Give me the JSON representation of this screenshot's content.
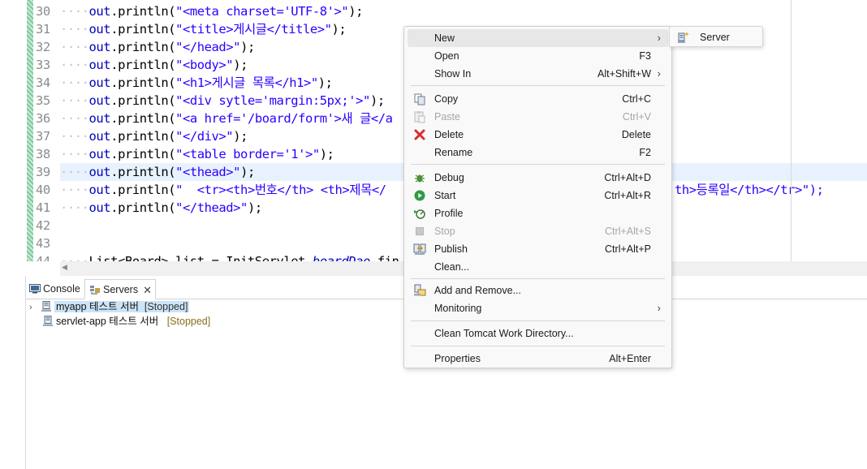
{
  "editor": {
    "lines": [
      {
        "num": "30",
        "ws": "····",
        "pre": "out",
        "mid": ".println(",
        "str": "\"<meta charset='UTF-8'>\"",
        "post": ");"
      },
      {
        "num": "31",
        "ws": "····",
        "pre": "out",
        "mid": ".println(",
        "str": "\"<title>게시글</title>\"",
        "post": ");"
      },
      {
        "num": "32",
        "ws": "····",
        "pre": "out",
        "mid": ".println(",
        "str": "\"</head>\"",
        "post": ");"
      },
      {
        "num": "33",
        "ws": "····",
        "pre": "out",
        "mid": ".println(",
        "str": "\"<body>\"",
        "post": ");"
      },
      {
        "num": "34",
        "ws": "····",
        "pre": "out",
        "mid": ".println(",
        "str": "\"<h1>게시글 목록</h1>\"",
        "post": ");"
      },
      {
        "num": "35",
        "ws": "····",
        "pre": "out",
        "mid": ".println(",
        "str": "\"<div sytle='margin:5px;'>\"",
        "post": ");"
      },
      {
        "num": "36",
        "ws": "····",
        "pre": "out",
        "mid": ".println(",
        "str": "\"<a href='/board/form'>새 글</a",
        "post": ""
      },
      {
        "num": "37",
        "ws": "····",
        "pre": "out",
        "mid": ".println(",
        "str": "\"</div>\"",
        "post": ");"
      },
      {
        "num": "38",
        "ws": "····",
        "pre": "out",
        "mid": ".println(",
        "str": "\"<table border='1'>\"",
        "post": ");"
      },
      {
        "num": "39",
        "ws": "····",
        "pre": "out",
        "mid": ".println(",
        "str": "\"<thead>\"",
        "post": ");"
      },
      {
        "num": "40",
        "ws": "····",
        "pre": "out",
        "mid": ".println(",
        "str": "\"  <tr><th>번호</th> <th>제목</",
        "post": ""
      },
      {
        "num": "41",
        "ws": "····",
        "pre": "out",
        "mid": ".println(",
        "str": "\"</thead>\"",
        "post": ");"
      },
      {
        "num": "42",
        "ws": "",
        "pre": "",
        "mid": "",
        "str": "",
        "post": ""
      },
      {
        "num": "43",
        "ws": "",
        "pre": "",
        "mid": "",
        "str": "",
        "post": ""
      },
      {
        "num": "44",
        "ws": "····",
        "pre": "List<Board> list = InitServlet.",
        "mid": "",
        "str": "",
        "post": "",
        "ital": "boardDao",
        "tail": ".fin"
      }
    ],
    "line40_tail": "th>등록일</th></tr>\");"
  },
  "panel": {
    "tabs": {
      "console": "Console",
      "servers": "Servers",
      "close": "✕"
    },
    "servers": [
      {
        "name": "myapp 테스트 서버",
        "status": "[Stopped]",
        "expander": "›"
      },
      {
        "name": "servlet-app 테스트 서버",
        "status": "[Stopped]"
      }
    ]
  },
  "context_menu": {
    "items": [
      {
        "label": "New",
        "accel": "",
        "submenu": true
      },
      {
        "label": "Open",
        "accel": "F3"
      },
      {
        "label": "Show In",
        "accel": "Alt+Shift+W",
        "submenu": true
      },
      {
        "label": "Copy",
        "accel": "Ctrl+C",
        "icon": "copy-icon"
      },
      {
        "label": "Paste",
        "accel": "Ctrl+V",
        "icon": "paste-icon",
        "disabled": true
      },
      {
        "label": "Delete",
        "accel": "Delete",
        "icon": "delete-icon"
      },
      {
        "label": "Rename",
        "accel": "F2"
      },
      {
        "label": "Debug",
        "accel": "Ctrl+Alt+D",
        "icon": "debug-icon"
      },
      {
        "label": "Start",
        "accel": "Ctrl+Alt+R",
        "icon": "start-icon"
      },
      {
        "label": "Profile",
        "accel": "",
        "icon": "profile-icon"
      },
      {
        "label": "Stop",
        "accel": "Ctrl+Alt+S",
        "icon": "stop-icon",
        "disabled": true
      },
      {
        "label": "Publish",
        "accel": "Ctrl+Alt+P",
        "icon": "publish-icon"
      },
      {
        "label": "Clean...",
        "accel": ""
      },
      {
        "label": "Add and Remove...",
        "accel": "",
        "icon": "add-remove-icon"
      },
      {
        "label": "Monitoring",
        "accel": "",
        "submenu": true
      },
      {
        "label": "Clean Tomcat Work Directory...",
        "accel": ""
      },
      {
        "label": "Properties",
        "accel": "Alt+Enter"
      }
    ],
    "submenu_arrow": "›"
  },
  "submenu": {
    "label": "Server",
    "icon": "new-server-icon"
  },
  "colors": {
    "current_line": "#e8f2fe",
    "string": "#2a00ff",
    "field": "#0000c0",
    "selection": "#cce4f7",
    "menu_bg": "#f9f9f9"
  }
}
